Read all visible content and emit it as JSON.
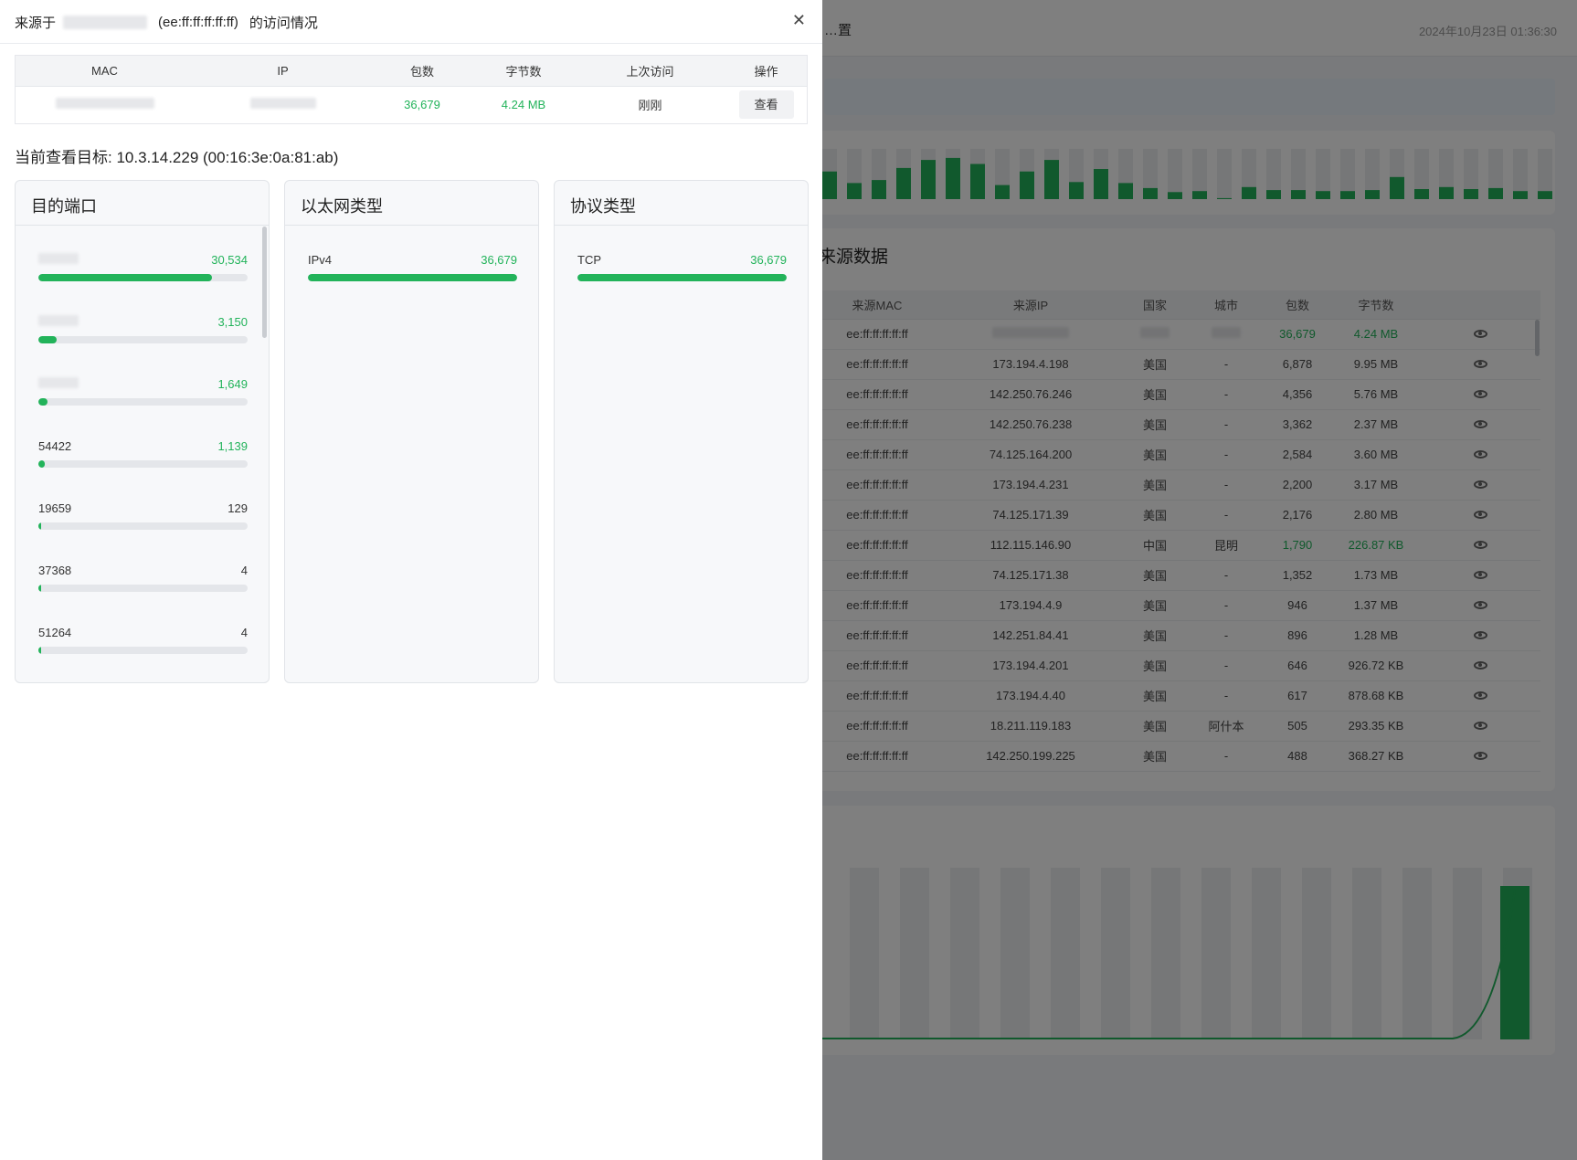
{
  "background": {
    "header_title": "…置",
    "header_time": "2024年10月23日 01:36:30",
    "section_title": "来源数据",
    "table": {
      "headers": [
        "来源MAC",
        "来源IP",
        "国家",
        "城市",
        "包数",
        "字节数",
        ""
      ],
      "rows": [
        {
          "mac": "ee:ff:ff:ff:ff:ff",
          "ip": "",
          "country": "",
          "city": "",
          "packets": "36,679",
          "bytes": "4.24 MB",
          "highlight": true
        },
        {
          "mac": "ee:ff:ff:ff:ff:ff",
          "ip": "173.194.4.198",
          "country": "美国",
          "city": "-",
          "packets": "6,878",
          "bytes": "9.95 MB",
          "highlight": false
        },
        {
          "mac": "ee:ff:ff:ff:ff:ff",
          "ip": "142.250.76.246",
          "country": "美国",
          "city": "-",
          "packets": "4,356",
          "bytes": "5.76 MB",
          "highlight": false
        },
        {
          "mac": "ee:ff:ff:ff:ff:ff",
          "ip": "142.250.76.238",
          "country": "美国",
          "city": "-",
          "packets": "3,362",
          "bytes": "2.37 MB",
          "highlight": false
        },
        {
          "mac": "ee:ff:ff:ff:ff:ff",
          "ip": "74.125.164.200",
          "country": "美国",
          "city": "-",
          "packets": "2,584",
          "bytes": "3.60 MB",
          "highlight": false
        },
        {
          "mac": "ee:ff:ff:ff:ff:ff",
          "ip": "173.194.4.231",
          "country": "美国",
          "city": "-",
          "packets": "2,200",
          "bytes": "3.17 MB",
          "highlight": false
        },
        {
          "mac": "ee:ff:ff:ff:ff:ff",
          "ip": "74.125.171.39",
          "country": "美国",
          "city": "-",
          "packets": "2,176",
          "bytes": "2.80 MB",
          "highlight": false
        },
        {
          "mac": "ee:ff:ff:ff:ff:ff",
          "ip": "112.115.146.90",
          "country": "中国",
          "city": "昆明",
          "packets": "1,790",
          "bytes": "226.87 KB",
          "highlight": true
        },
        {
          "mac": "ee:ff:ff:ff:ff:ff",
          "ip": "74.125.171.38",
          "country": "美国",
          "city": "-",
          "packets": "1,352",
          "bytes": "1.73 MB",
          "highlight": false
        },
        {
          "mac": "ee:ff:ff:ff:ff:ff",
          "ip": "173.194.4.9",
          "country": "美国",
          "city": "-",
          "packets": "946",
          "bytes": "1.37 MB",
          "highlight": false
        },
        {
          "mac": "ee:ff:ff:ff:ff:ff",
          "ip": "142.251.84.41",
          "country": "美国",
          "city": "-",
          "packets": "896",
          "bytes": "1.28 MB",
          "highlight": false
        },
        {
          "mac": "ee:ff:ff:ff:ff:ff",
          "ip": "173.194.4.201",
          "country": "美国",
          "city": "-",
          "packets": "646",
          "bytes": "926.72 KB",
          "highlight": false
        },
        {
          "mac": "ee:ff:ff:ff:ff:ff",
          "ip": "173.194.4.40",
          "country": "美国",
          "city": "-",
          "packets": "617",
          "bytes": "878.68 KB",
          "highlight": false
        },
        {
          "mac": "ee:ff:ff:ff:ff:ff",
          "ip": "18.211.119.183",
          "country": "美国",
          "city": "阿什本",
          "packets": "505",
          "bytes": "293.35 KB",
          "highlight": false
        },
        {
          "mac": "ee:ff:ff:ff:ff:ff",
          "ip": "142.250.199.225",
          "country": "美国",
          "city": "-",
          "packets": "488",
          "bytes": "368.27 KB",
          "highlight": false
        }
      ]
    },
    "colors": {
      "accent": "#22b35a",
      "bar": "#22b35a"
    }
  },
  "drawer": {
    "title_prefix": "来源于",
    "title_mac": "(ee:ff:ff:ff:ff:ff)",
    "title_suffix": "的访问情况",
    "close_icon": "close-icon",
    "summary_table": {
      "headers": [
        "MAC",
        "IP",
        "包数",
        "字节数",
        "上次访问",
        "操作"
      ],
      "row": {
        "mac": "",
        "ip": "",
        "packets": "36,679",
        "bytes": "4.24 MB",
        "last_access": "刚刚",
        "action_label": "查看"
      }
    },
    "target_label": "当前查看目标:",
    "target_value": "10.3.14.229 (00:16:3e:0a:81:ab)",
    "cards": [
      {
        "title": "目的端口",
        "items": [
          {
            "label": "",
            "value": "30,534",
            "fraction": 0.83,
            "highlight": true
          },
          {
            "label": "",
            "value": "3,150",
            "fraction": 0.086,
            "highlight": true
          },
          {
            "label": "",
            "value": "1,649",
            "fraction": 0.045,
            "highlight": true
          },
          {
            "label": "54422",
            "value": "1,139",
            "fraction": 0.031,
            "highlight": true
          },
          {
            "label": "19659",
            "value": "129",
            "fraction": 0.0035,
            "highlight": false
          },
          {
            "label": "37368",
            "value": "4",
            "fraction": 0.0001,
            "highlight": false
          },
          {
            "label": "51264",
            "value": "4",
            "fraction": 0.0001,
            "highlight": false
          }
        ]
      },
      {
        "title": "以太网类型",
        "items": [
          {
            "label": "IPv4",
            "value": "36,679",
            "fraction": 1.0,
            "highlight": true
          }
        ]
      },
      {
        "title": "协议类型",
        "items": [
          {
            "label": "TCP",
            "value": "36,679",
            "fraction": 1.0,
            "highlight": true
          }
        ]
      }
    ]
  }
}
